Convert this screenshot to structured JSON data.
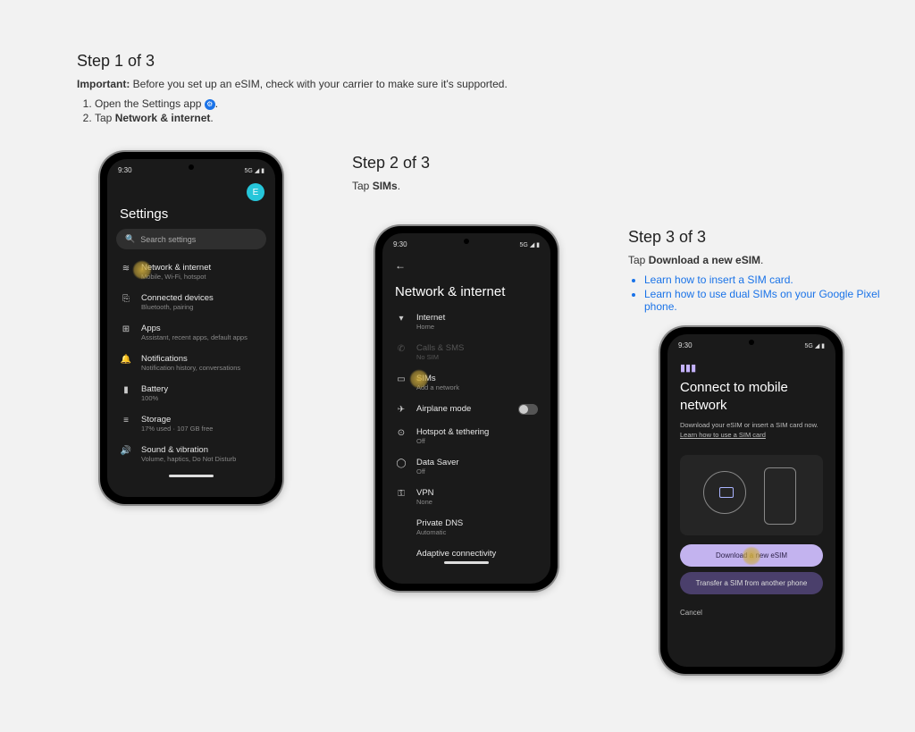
{
  "step1": {
    "title": "Step 1 of 3",
    "important_label": "Important:",
    "important_text": " Before you set up an eSIM, check with your carrier to make sure it's supported.",
    "li1_pre": "Open the Settings app ",
    "li1_post": ".",
    "li2_pre": "Tap ",
    "li2_bold": "Network & internet",
    "li2_post": "."
  },
  "step2": {
    "title": "Step 2 of 3",
    "text_pre": "Tap ",
    "text_bold": "SIMs",
    "text_post": "."
  },
  "step3": {
    "title": "Step 3 of 3",
    "text_pre": "Tap ",
    "text_bold": "Download a new eSIM",
    "text_post": ".",
    "link1": "Learn how to insert a SIM card.",
    "link2": "Learn how to use dual SIMs on your Google Pixel phone."
  },
  "status_time": "9:30",
  "status_right": "5G ◢ ▮",
  "avatar_letter": "E",
  "phone1": {
    "title": "Settings",
    "search": "Search settings",
    "rows": [
      {
        "icon": "≋",
        "t1": "Network & internet",
        "t2": "Mobile, Wi-Fi, hotspot"
      },
      {
        "icon": "⎘",
        "t1": "Connected devices",
        "t2": "Bluetooth, pairing"
      },
      {
        "icon": "⊞",
        "t1": "Apps",
        "t2": "Assistant, recent apps, default apps"
      },
      {
        "icon": "🔔",
        "t1": "Notifications",
        "t2": "Notification history, conversations"
      },
      {
        "icon": "▮",
        "t1": "Battery",
        "t2": "100%"
      },
      {
        "icon": "≡",
        "t1": "Storage",
        "t2": "17% used · 107 GB free"
      },
      {
        "icon": "🔊",
        "t1": "Sound & vibration",
        "t2": "Volume, haptics, Do Not Disturb"
      }
    ]
  },
  "phone2": {
    "title": "Network & internet",
    "rows": [
      {
        "icon": "▾",
        "t1": "Internet",
        "t2": "Home"
      },
      {
        "icon": "✆",
        "t1": "Calls & SMS",
        "t2": "No SIM",
        "dim": true
      },
      {
        "icon": "▭",
        "t1": "SIMs",
        "t2": "Add a network",
        "highlight": true
      },
      {
        "icon": "✈",
        "t1": "Airplane mode",
        "t2": "",
        "toggle": true
      },
      {
        "icon": "⊙",
        "t1": "Hotspot & tethering",
        "t2": "Off"
      },
      {
        "icon": "◯",
        "t1": "Data Saver",
        "t2": "Off"
      },
      {
        "icon": "⚿",
        "t1": "VPN",
        "t2": "None"
      }
    ],
    "extra1_t1": "Private DNS",
    "extra1_t2": "Automatic",
    "extra2": "Adaptive connectivity"
  },
  "phone3": {
    "title_l1": "Connect to mobile",
    "title_l2": "network",
    "sub": "Download your eSIM or insert a SIM card now.",
    "link": "Learn how to use a SIM card",
    "btn1": "Download a new eSIM",
    "btn2": "Transfer a SIM from another phone",
    "cancel": "Cancel"
  }
}
